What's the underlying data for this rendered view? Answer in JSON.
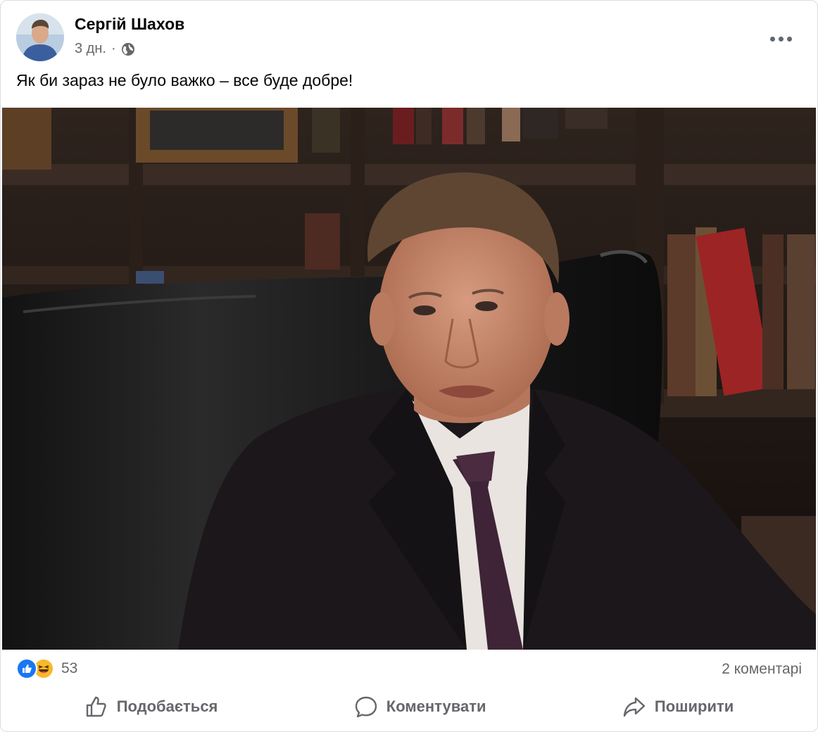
{
  "post": {
    "author": "Сергій Шахов",
    "time": "3 дн.",
    "separator": "·",
    "audience_icon": "globe-icon",
    "text": "Як би зараз не було важко – все буде добре!"
  },
  "stats": {
    "reaction_icons": [
      "like-icon",
      "haha-icon"
    ],
    "reaction_count": "53",
    "comments": "2 коментарі"
  },
  "actions": {
    "like": "Подобається",
    "comment": "Коментувати",
    "share": "Поширити"
  },
  "colors": {
    "accent": "#1877f2",
    "haha": "#f7b928",
    "secondary_text": "#65676b"
  }
}
